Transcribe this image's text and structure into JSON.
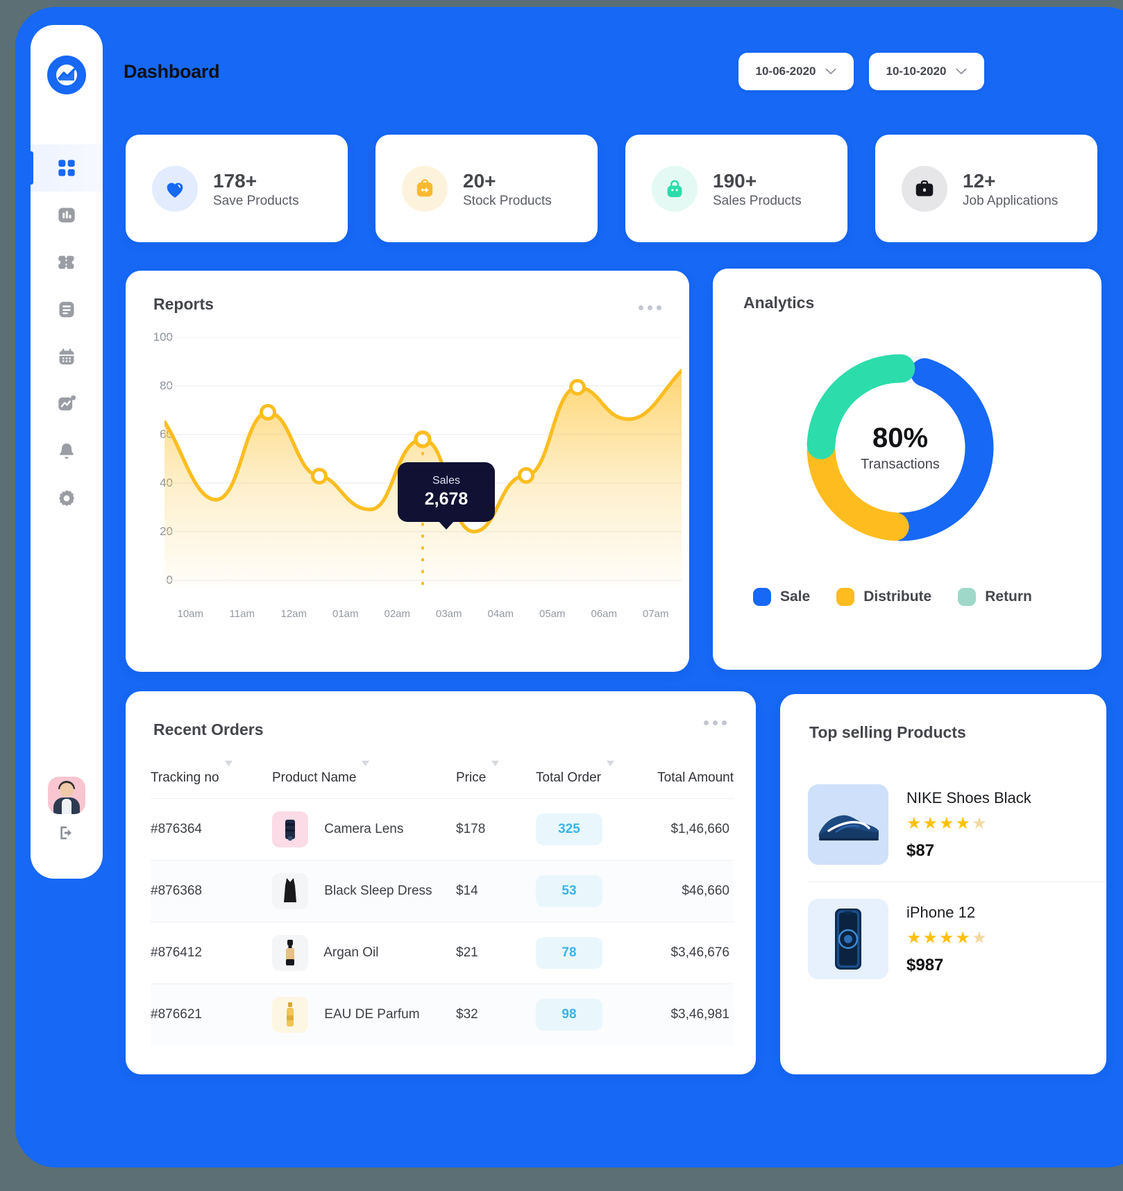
{
  "header": {
    "title": "Dashboard",
    "date_from": "10-06-2020",
    "date_to": "10-10-2020",
    "chevron": "chevron-down-icon"
  },
  "sidebar": {
    "logo": "analytics-logo-icon",
    "items": [
      {
        "icon": "grid-dashboard-icon",
        "active": true
      },
      {
        "icon": "bar-chart-icon",
        "active": false
      },
      {
        "icon": "ticket-icon",
        "active": false
      },
      {
        "icon": "document-icon",
        "active": false
      },
      {
        "icon": "calendar-icon",
        "active": false
      },
      {
        "icon": "trending-chart-icon",
        "active": false
      },
      {
        "icon": "bell-icon",
        "active": false
      },
      {
        "icon": "gear-icon",
        "active": false
      }
    ],
    "avatar": "user-avatar",
    "logout": "logout-icon"
  },
  "stats": [
    {
      "value": "178+",
      "label": "Save Products",
      "icon": "heart-icon",
      "icon_color": "#1668f5",
      "bg": "#e2ecfe"
    },
    {
      "value": "20+",
      "label": "Stock Products",
      "icon": "box-icon",
      "icon_color": "#ffb931",
      "bg": "#fdf3dd"
    },
    {
      "value": "190+",
      "label": "Sales Products",
      "icon": "shopping-bag-icon",
      "icon_color": "#2ddcab",
      "bg": "#e4f9f3"
    },
    {
      "value": "12+",
      "label": "Job Applications",
      "icon": "briefcase-icon",
      "icon_color": "#15161b",
      "bg": "#e6e6e8"
    }
  ],
  "reports": {
    "title": "Reports",
    "menu": "more-options-icon",
    "tooltip": {
      "label": "Sales",
      "value": "2,678"
    }
  },
  "analytics": {
    "title": "Analytics",
    "center_value": "80%",
    "center_label": "Transactions",
    "legend": [
      {
        "label": "Sale",
        "color": "#1668f5"
      },
      {
        "label": "Distribute",
        "color": "#febc1f"
      },
      {
        "label": "Return",
        "color": "#9fd8c8"
      }
    ]
  },
  "orders": {
    "title": "Recent Orders",
    "menu": "more-options-icon",
    "columns": [
      "Tracking no",
      "Product Name",
      "Price",
      "Total Order",
      "Total Amount"
    ],
    "sort_icon": "sort-descending-icon",
    "rows": [
      {
        "tracking": "#876364",
        "product": "Camera Lens",
        "price": "$178",
        "order": "325",
        "amount": "$1,46,660",
        "thumb": "camera-lens-thumbnail",
        "thumb_bg": "#fbdbe6"
      },
      {
        "tracking": "#876368",
        "product": "Black Sleep Dress",
        "price": "$14",
        "order": "53",
        "amount": "$46,660",
        "thumb": "black-dress-thumbnail",
        "thumb_bg": "#f4f5f7"
      },
      {
        "tracking": "#876412",
        "product": "Argan Oil",
        "price": "$21",
        "order": "78",
        "amount": "$3,46,676",
        "thumb": "argan-oil-thumbnail",
        "thumb_bg": "#f4f5f7"
      },
      {
        "tracking": "#876621",
        "product": "EAU DE Parfum",
        "price": "$32",
        "order": "98",
        "amount": "$3,46,981",
        "thumb": "perfume-thumbnail",
        "thumb_bg": "#fdf6e3"
      }
    ]
  },
  "topselling": {
    "title": "Top selling Products",
    "products": [
      {
        "name": "NIKE Shoes Black",
        "price": "$87",
        "rating": 4,
        "thumb": "nike-shoe-thumbnail",
        "thumb_bg": "#cfe0fa"
      },
      {
        "name": "iPhone 12",
        "price": "$987",
        "rating": 4,
        "thumb": "iphone-12-thumbnail",
        "thumb_bg": "#e7f0fd"
      }
    ]
  },
  "chart_data": {
    "type": "area",
    "title": "Reports",
    "xlabel": "",
    "ylabel": "",
    "x": [
      "10am",
      "11am",
      "12am",
      "01am",
      "02am",
      "03am",
      "04am",
      "05am",
      "06am",
      "07am"
    ],
    "values": [
      65,
      33,
      68,
      43,
      41,
      58,
      20,
      43,
      80,
      67
    ],
    "ylim": [
      0,
      100
    ],
    "yticks": [
      0,
      20,
      40,
      60,
      80,
      100
    ],
    "grid": true,
    "series_color": "#fcbd20",
    "markers": [
      {
        "x": "12am",
        "y": 68
      },
      {
        "x": "01am",
        "y": 43
      },
      {
        "x": "03am",
        "y": 58,
        "highlighted": true
      },
      {
        "x": "05am",
        "y": 43
      },
      {
        "x": "06am",
        "y": 80
      }
    ],
    "annotation": {
      "label": "Sales",
      "value": "2,678",
      "at_x": "03am"
    }
  },
  "donut_data": {
    "type": "pie",
    "title": "Analytics",
    "labels": [
      "Sale",
      "Distribute",
      "Return"
    ],
    "values": [
      45,
      25,
      30
    ],
    "colors": [
      "#1668f5",
      "#febc1f",
      "#2ddcab"
    ],
    "center_value": "80%",
    "center_label": "Transactions",
    "legend_position": "bottom"
  }
}
